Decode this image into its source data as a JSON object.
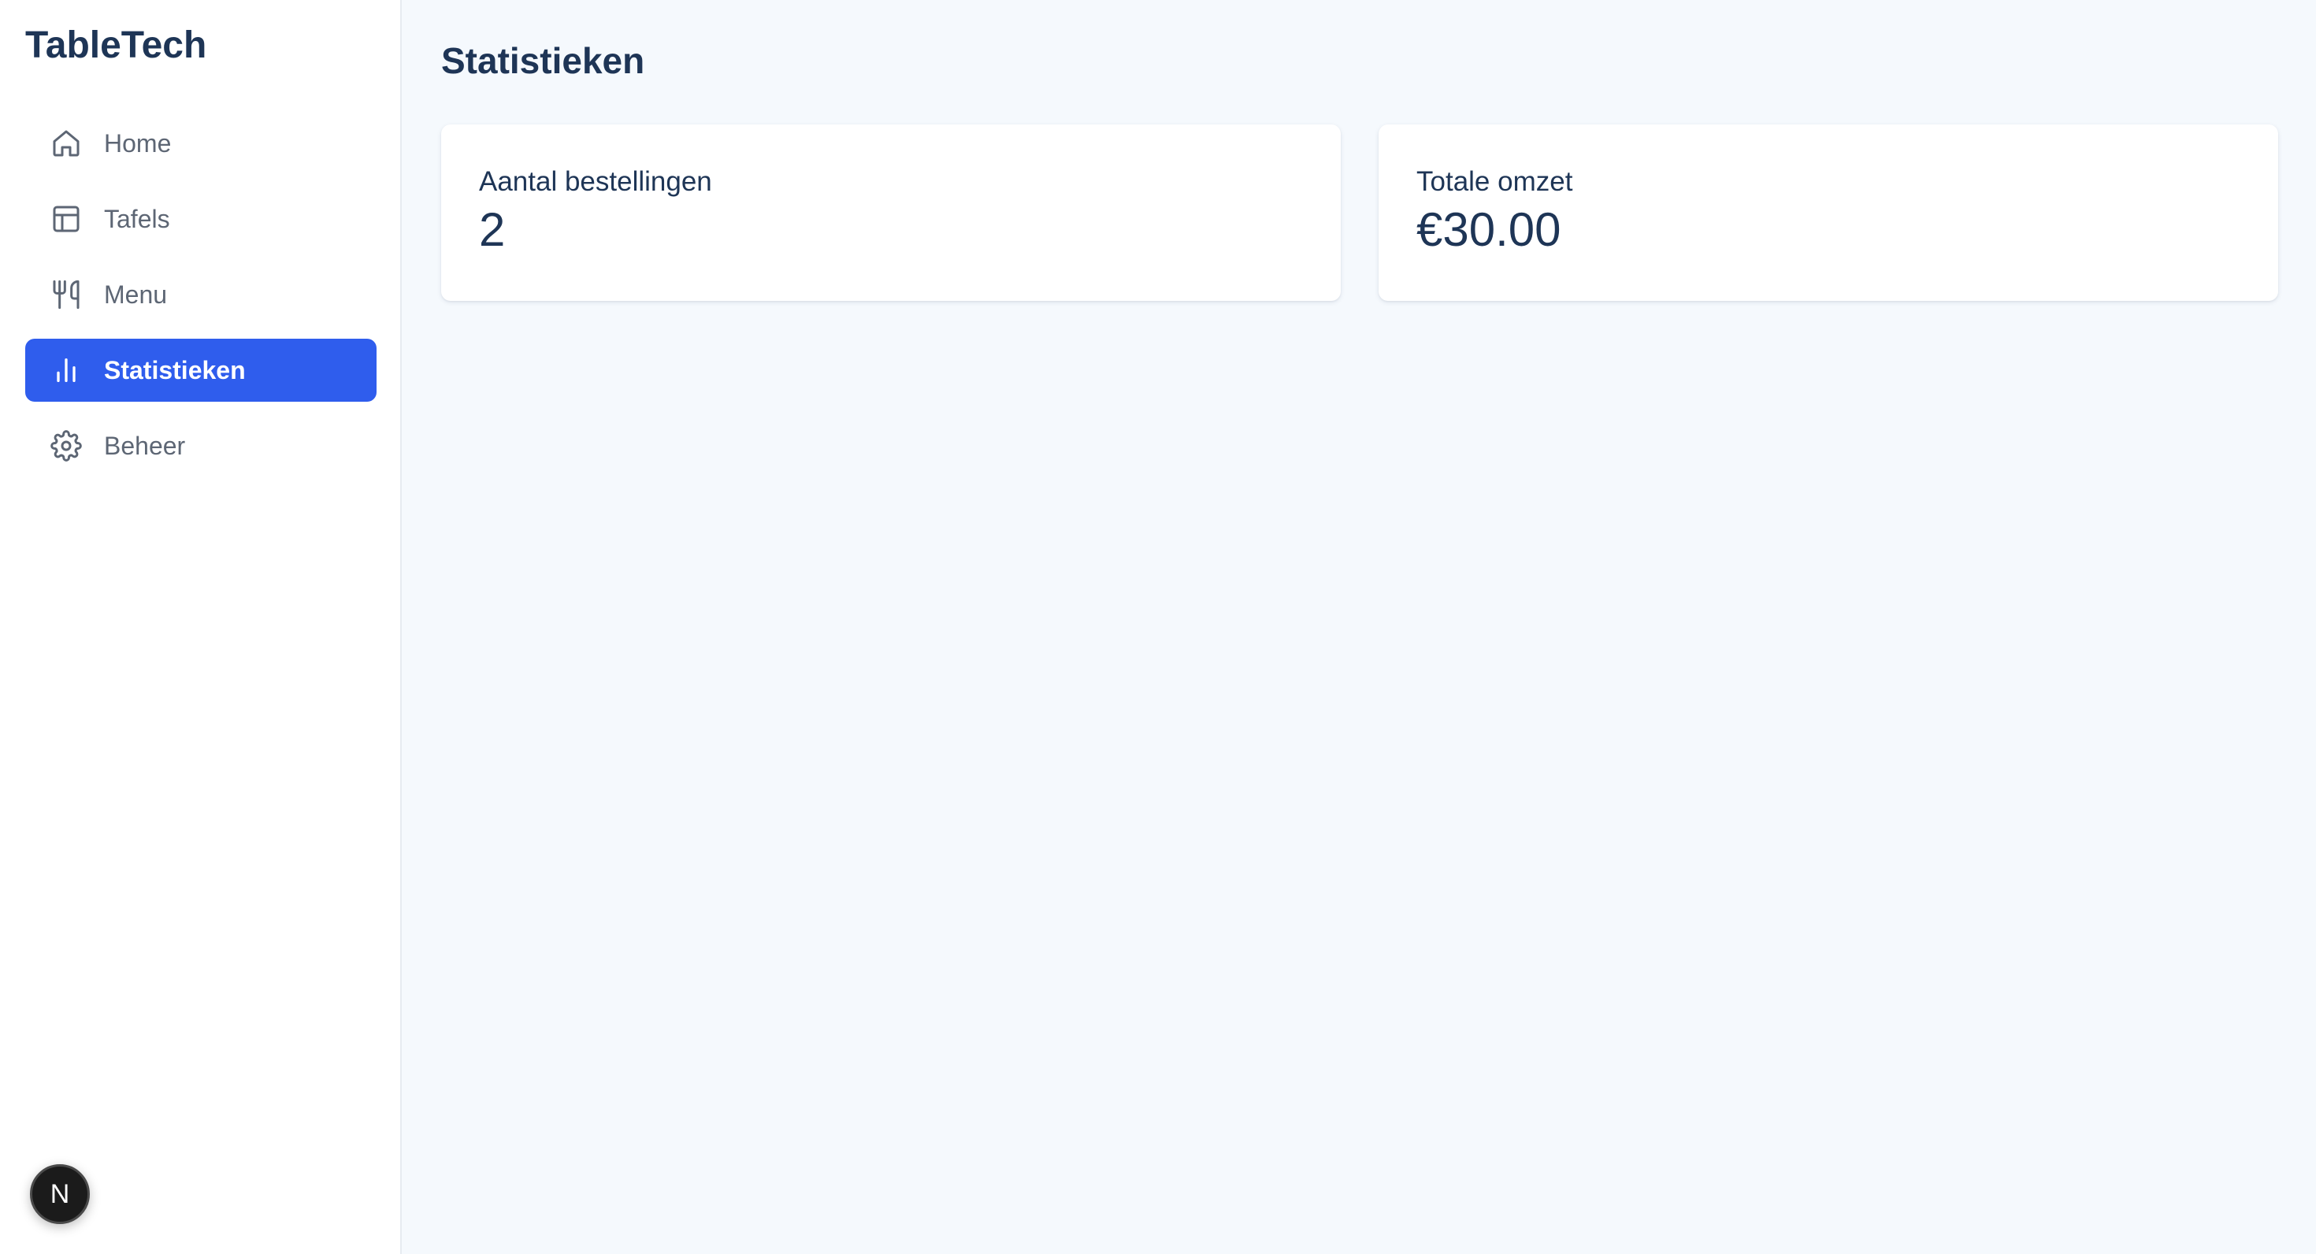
{
  "app": {
    "brand": "TableTech"
  },
  "sidebar": {
    "items": [
      {
        "label": "Home",
        "icon": "home-icon",
        "active": false
      },
      {
        "label": "Tafels",
        "icon": "table-icon",
        "active": false
      },
      {
        "label": "Menu",
        "icon": "utensils-icon",
        "active": false
      },
      {
        "label": "Statistieken",
        "icon": "bar-chart-icon",
        "active": true
      },
      {
        "label": "Beheer",
        "icon": "gear-icon",
        "active": false
      }
    ],
    "badge": "N"
  },
  "main": {
    "title": "Statistieken",
    "cards": [
      {
        "label": "Aantal bestellingen",
        "value": "2"
      },
      {
        "label": "Totale omzet",
        "value": "€30.00"
      }
    ]
  },
  "colors": {
    "accent": "#2f5ded",
    "text_dark": "#1e3556",
    "text_muted": "#5d6674",
    "background": "#f5f9fd"
  }
}
